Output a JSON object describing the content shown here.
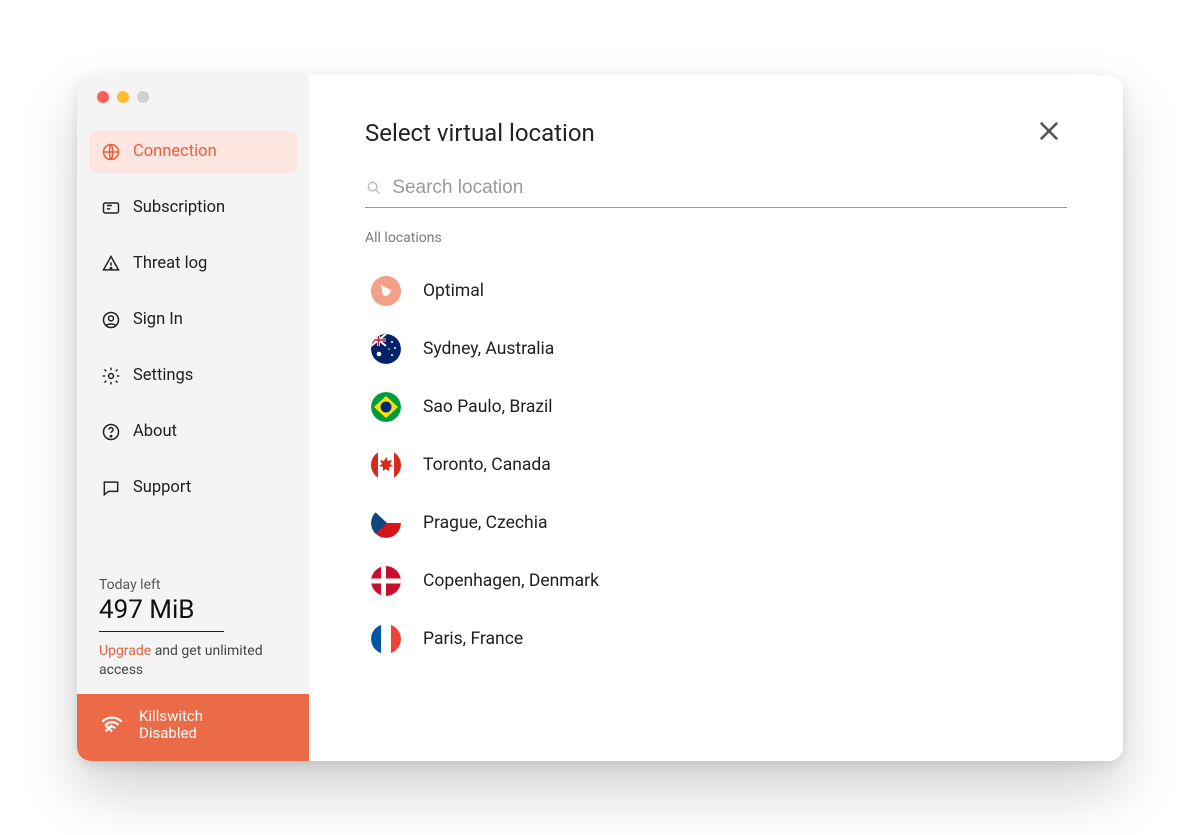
{
  "sidebar": {
    "items": [
      {
        "key": "connection",
        "label": "Connection",
        "icon": "globe-icon",
        "active": true
      },
      {
        "key": "subscription",
        "label": "Subscription",
        "icon": "ticket-icon",
        "active": false
      },
      {
        "key": "threatlog",
        "label": "Threat log",
        "icon": "alert-icon",
        "active": false
      },
      {
        "key": "signin",
        "label": "Sign In",
        "icon": "user-icon",
        "active": false
      },
      {
        "key": "settings",
        "label": "Settings",
        "icon": "gear-icon",
        "active": false
      },
      {
        "key": "about",
        "label": "About",
        "icon": "help-icon",
        "active": false
      },
      {
        "key": "support",
        "label": "Support",
        "icon": "chat-icon",
        "active": false
      }
    ],
    "quota": {
      "caption": "Today left",
      "amount": "497 MiB",
      "upgrade_link": "Upgrade",
      "upgrade_rest": " and get unlimited access"
    },
    "killswitch": {
      "line1": "Killswitch",
      "line2": "Disabled"
    }
  },
  "main": {
    "title": "Select virtual location",
    "search_placeholder": "Search location",
    "section_label": "All locations",
    "locations": [
      {
        "key": "optimal",
        "label": "Optimal",
        "flag": "optimal"
      },
      {
        "key": "au",
        "label": "Sydney, Australia",
        "flag": "au"
      },
      {
        "key": "br",
        "label": "Sao Paulo, Brazil",
        "flag": "br"
      },
      {
        "key": "ca",
        "label": "Toronto, Canada",
        "flag": "ca"
      },
      {
        "key": "cz",
        "label": "Prague, Czechia",
        "flag": "cz"
      },
      {
        "key": "dk",
        "label": "Copenhagen, Denmark",
        "flag": "dk"
      },
      {
        "key": "fr",
        "label": "Paris, France",
        "flag": "fr"
      }
    ]
  },
  "colors": {
    "accent": "#e6603f",
    "sidebar_bg": "#f4f4f4",
    "killswitch_bg": "#eb6a47"
  }
}
